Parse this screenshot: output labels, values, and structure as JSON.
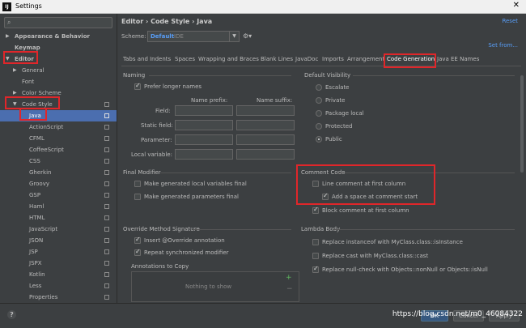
{
  "window": {
    "title": "Settings",
    "app_icon": "intellij-icon"
  },
  "sidebar": {
    "search_placeholder": "",
    "items": [
      {
        "label": "Appearance & Behavior",
        "arrow": "▶",
        "bold": true
      },
      {
        "label": "Keymap",
        "arrow": "",
        "bold": true
      },
      {
        "label": "Editor",
        "arrow": "▼",
        "bold": true
      },
      {
        "label": "General",
        "arrow": "▶"
      },
      {
        "label": "Font",
        "arrow": ""
      },
      {
        "label": "Color Scheme",
        "arrow": "▶"
      },
      {
        "label": "Code Style",
        "arrow": "▼"
      },
      {
        "label": "Java",
        "arrow": "",
        "selected": true
      },
      {
        "label": "ActionScript"
      },
      {
        "label": "CFML"
      },
      {
        "label": "CoffeeScript"
      },
      {
        "label": "CSS"
      },
      {
        "label": "Gherkin"
      },
      {
        "label": "Groovy"
      },
      {
        "label": "GSP"
      },
      {
        "label": "Haml"
      },
      {
        "label": "HTML"
      },
      {
        "label": "JavaScript"
      },
      {
        "label": "JSON"
      },
      {
        "label": "JSP"
      },
      {
        "label": "JSPX"
      },
      {
        "label": "Kotlin"
      },
      {
        "label": "Less"
      },
      {
        "label": "Properties"
      }
    ]
  },
  "main": {
    "breadcrumb": "Editor  ›  Code Style  ›  Java",
    "reset": "Reset",
    "scheme_label": "Scheme:",
    "scheme_value": "Default",
    "scheme_scope": "IDE",
    "set_from": "Set from...",
    "tabs": [
      "Tabs and Indents",
      "Spaces",
      "Wrapping and Braces",
      "Blank Lines",
      "JavaDoc",
      "Imports",
      "Arrangement",
      "Code Generation",
      "Java EE Names"
    ],
    "active_tab": 7,
    "naming": {
      "title": "Naming",
      "prefer_longer": "Prefer longer names",
      "prefix_header": "Name prefix:",
      "suffix_header": "Name suffix:",
      "rows": [
        "Field:",
        "Static field:",
        "Parameter:",
        "Local variable:"
      ]
    },
    "visibility": {
      "title": "Default Visibility",
      "options": [
        "Escalate",
        "Private",
        "Package local",
        "Protected",
        "Public"
      ],
      "selected": 4
    },
    "final_modifier": {
      "title": "Final Modifier",
      "items": [
        "Make generated local variables final",
        "Make generated parameters final"
      ]
    },
    "comment_code": {
      "title": "Comment Code",
      "line_comment": "Line comment at first column",
      "add_space": "Add a space at comment start",
      "block_comment": "Block comment at first column"
    },
    "override": {
      "title": "Override Method Signature",
      "insert_override": "Insert @Override annotation",
      "repeat_sync": "Repeat synchronized modifier",
      "annotations_title": "Annotations to Copy",
      "empty_text": "Nothing to show",
      "add_sign": "+",
      "remove_sign": "−"
    },
    "lambda": {
      "title": "Lambda Body",
      "items": [
        "Replace instanceof with MyClass.class::isInstance",
        "Replace cast with MyClass.class::cast",
        "Replace null-check with Objects::nonNull or Objects::isNull"
      ]
    }
  },
  "footer": {
    "help": "?",
    "ok": "OK",
    "cancel": "Cancel",
    "apply": "Apply",
    "watermark": "https://blog.csdn.net/m0_46084322"
  },
  "colors": {
    "accent": "#4b6eaf",
    "highlight": "#e0262a",
    "link": "#589df6"
  }
}
